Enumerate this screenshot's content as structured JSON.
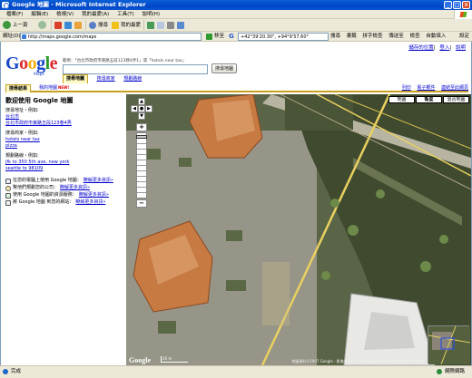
{
  "window": {
    "title": "Google 地圖 - Microsoft Internet Explorer",
    "min": "_",
    "max": "□",
    "close": "×"
  },
  "menu": [
    "檔案(F)",
    "編輯(E)",
    "檢視(V)",
    "我的最愛(A)",
    "工具(T)",
    "說明(H)"
  ],
  "toolbar": {
    "back": "上一頁",
    "search": "搜尋",
    "favorites": "我的最愛"
  },
  "address": {
    "label": "網址(D)",
    "url": "http://maps.google.com/maps",
    "go": "移至"
  },
  "gbar": {
    "query": "+42°39'20.30\", +94°9'57.60\"",
    "items": [
      "搜尋",
      "書籤",
      "拼字檢查",
      "傳送至",
      "檢查",
      "自動填入"
    ],
    "settings": "設定"
  },
  "toplinks": {
    "saved": "儲存的位置",
    "login": "登入",
    "help": "說明"
  },
  "logo": {
    "g1": "G",
    "o1": "o",
    "o2": "o",
    "g2": "g",
    "l": "l",
    "e": "e",
    "sub": "Maps"
  },
  "search": {
    "example": "範例：「台北市政府市東路五段123巷4弄1」或「hotels near tax」",
    "button": "搜尋地圖"
  },
  "tabs": [
    "搜尋地圖",
    "搜尋商家",
    "規劃路線"
  ],
  "subbar": {
    "tab1": "搜尋結果",
    "tab2": "我的地圖",
    "new": "NEW!",
    "links": [
      "列印",
      "電子郵件",
      "連結至此網頁"
    ]
  },
  "sidebar": {
    "title": "歡迎使用 Google 地圖",
    "addr_label": "搜尋地址・例如:",
    "addr_ex1": "台北市",
    "addr_ex2": "台北市政府市東路五段123巷4弄",
    "biz_label": "搜尋商家・例如:",
    "biz_ex1": "hotels near tax",
    "biz_ex2": "pizza",
    "route_label": "規劃路線・例如:",
    "route_ex1": "jfk to 350 5th ave, new york",
    "route_ex2": "seattle to 98109",
    "features": [
      {
        "text": "在您的電腦上使用 Google 地圖：",
        "link": "瞭解更多資訊»"
      },
      {
        "text": "幫他們規劃您的公司：",
        "link": "瞭解更多資訊»"
      },
      {
        "text": "使用 Google 地圖的資源服務：",
        "link": "瞭解更多資訊»"
      },
      {
        "text": "將 Google 地圖 到您的網站：",
        "link": "瞭解更多資訊»"
      }
    ]
  },
  "map": {
    "types": [
      "地圖",
      "衛星",
      "混合地圖"
    ],
    "copyright": "地圖資料©2007 Google - 影像©2007 DigitalGlobe, 地圖資料©2007 Google",
    "scale": "20 m"
  },
  "status": {
    "left": "完成",
    "right": "網際網路"
  }
}
